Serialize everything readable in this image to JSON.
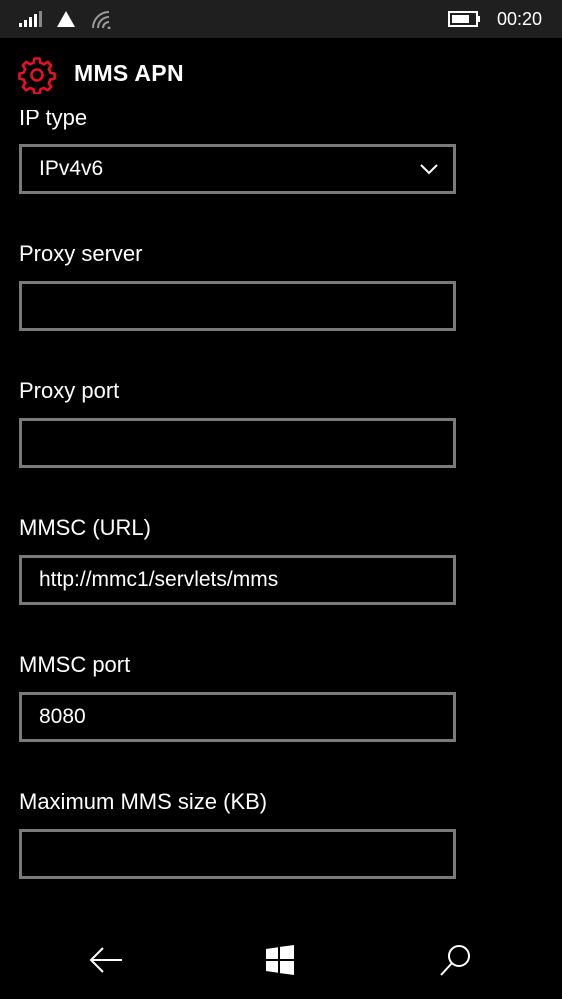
{
  "status_bar": {
    "time": "00:20",
    "icons": [
      "signal-icon",
      "triangle-icon",
      "wifi-icon",
      "battery-icon"
    ]
  },
  "header": {
    "icon": "gear-icon",
    "title": "MMS APN",
    "accent_color": "#e81123"
  },
  "fields": [
    {
      "label": "IP type",
      "value": "IPv4v6",
      "type": "dropdown"
    },
    {
      "label": "Proxy server",
      "value": "",
      "type": "text"
    },
    {
      "label": "Proxy port",
      "value": "",
      "type": "text"
    },
    {
      "label": "MMSC (URL)",
      "value": "http://mmc1/servlets/mms",
      "type": "text"
    },
    {
      "label": "MMSC port",
      "value": "8080",
      "type": "text"
    },
    {
      "label": "Maximum MMS size (KB)",
      "value": "",
      "type": "text"
    }
  ],
  "nav": {
    "back_icon": "back-arrow-icon",
    "start_icon": "windows-start-icon",
    "search_icon": "search-icon"
  }
}
